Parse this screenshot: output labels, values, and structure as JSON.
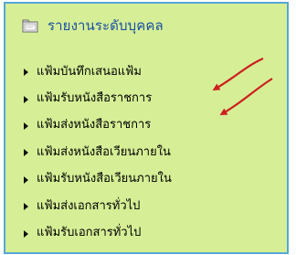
{
  "panel": {
    "title": "รายงานระดับบุคคล",
    "icon": "folder-icon",
    "colors": {
      "background": "#d6ef96",
      "border": "#58a6d4",
      "title": "#1a4fa6",
      "arrow": "#cc1f1f"
    },
    "items": [
      {
        "label": "แฟ้มบันทึกเสนอแฟ้ม"
      },
      {
        "label": "แฟ้มรับหนังสือราชการ"
      },
      {
        "label": "แฟ้มส่งหนังสือราชการ"
      },
      {
        "label": "แฟ้มส่งหนังสือเวียนภายใน"
      },
      {
        "label": "แฟ้มรับหนังสือเวียนภายใน"
      },
      {
        "label": "แฟ้มส่งเอกสารทั่วไป"
      },
      {
        "label": "แฟ้มรับเอกสารทั่วไป"
      }
    ]
  }
}
